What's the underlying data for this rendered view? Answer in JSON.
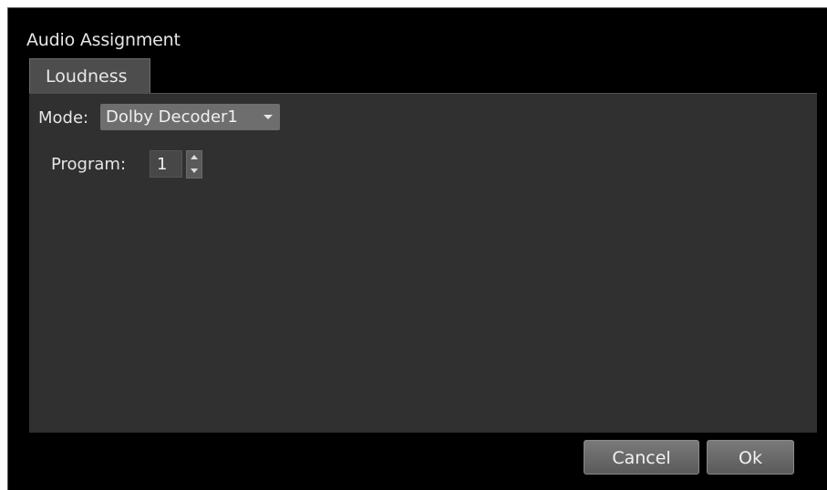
{
  "dialog": {
    "title": "Audio Assignment",
    "tabs": [
      {
        "label": "Loudness",
        "active": true
      }
    ],
    "mode": {
      "label": "Mode:",
      "selected": "Dolby Decoder1"
    },
    "program": {
      "label": "Program:",
      "value": "1"
    },
    "buttons": {
      "cancel": "Cancel",
      "ok": "Ok"
    }
  },
  "colors": {
    "background": "#000000",
    "panel": "#303030",
    "tab": "#4d4d4d",
    "select": "#6e6e6e",
    "text": "#e6e6e6"
  }
}
